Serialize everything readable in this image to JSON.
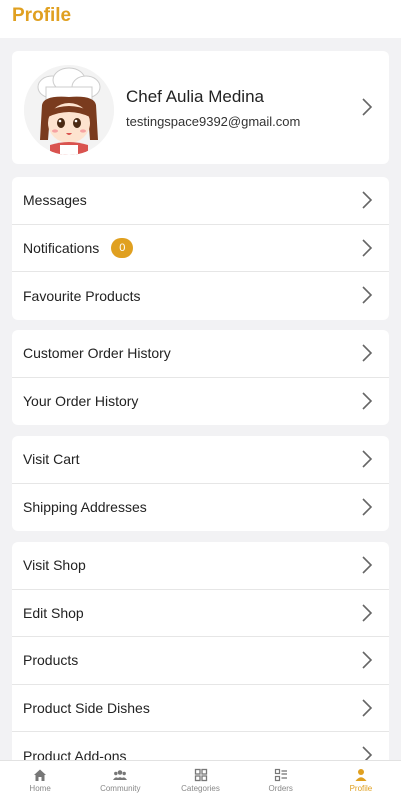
{
  "header": {
    "title": "Profile"
  },
  "profile": {
    "name": "Chef Aulia Medina",
    "email": "testingspace9392@gmail.com"
  },
  "groups": [
    {
      "items": [
        {
          "label": "Messages"
        },
        {
          "label": "Notifications",
          "badge": "0"
        },
        {
          "label": "Favourite Products"
        }
      ]
    },
    {
      "items": [
        {
          "label": "Customer Order History"
        },
        {
          "label": "Your Order History"
        }
      ]
    },
    {
      "items": [
        {
          "label": "Visit Cart"
        },
        {
          "label": "Shipping Addresses"
        }
      ]
    },
    {
      "items": [
        {
          "label": "Visit Shop"
        },
        {
          "label": "Edit Shop"
        },
        {
          "label": "Products"
        },
        {
          "label": "Product Side Dishes"
        },
        {
          "label": "Product Add-ons"
        }
      ]
    }
  ],
  "nav": {
    "items": [
      {
        "label": "Home",
        "icon": "home-icon"
      },
      {
        "label": "Community",
        "icon": "community-icon"
      },
      {
        "label": "Categories",
        "icon": "categories-icon"
      },
      {
        "label": "Orders",
        "icon": "orders-icon"
      },
      {
        "label": "Profile",
        "icon": "profile-icon",
        "active": true
      }
    ]
  },
  "colors": {
    "accent": "#e0a020",
    "background": "#f2f2f4"
  }
}
